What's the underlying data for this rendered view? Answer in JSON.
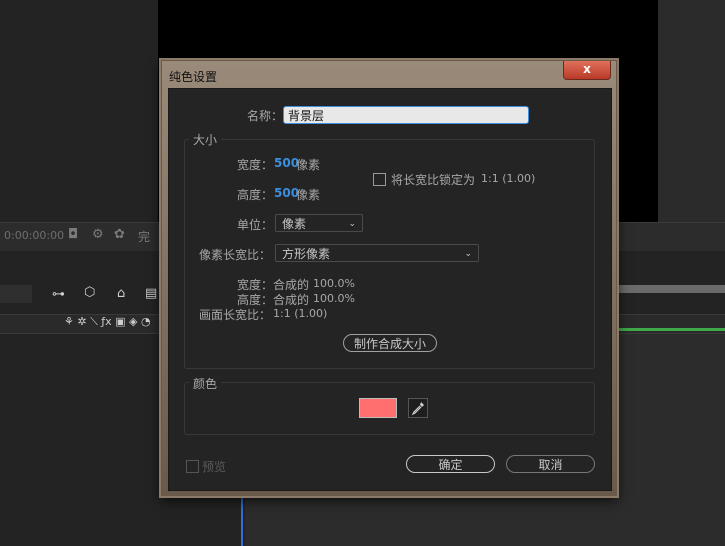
{
  "background": {
    "timecode": "0:00:00:00",
    "complete_label": "完"
  },
  "dialog": {
    "title": "纯色设置",
    "close_symbol": "x",
    "name_label": "名称：",
    "name_value": "背景层",
    "size_group": {
      "legend": "大小",
      "width_label": "宽度：",
      "width_value": "500",
      "width_unit": "像素",
      "height_label": "高度：",
      "height_value": "500",
      "height_unit": "像素",
      "lock_aspect_label": "将长宽比锁定为",
      "lock_aspect_value": "1:1 (1.00)",
      "units_label": "单位：",
      "units_value": "像素",
      "pixel_aspect_label": "像素长宽比：",
      "pixel_aspect_value": "方形像素",
      "info_width_label": "宽度：",
      "info_width_text": "合成的",
      "info_width_value": "100.0%",
      "info_height_label": "高度：",
      "info_height_text": "合成的",
      "info_height_value": "100.0%",
      "frame_aspect_label": "画面长宽比：",
      "frame_aspect_value": "1:1 (1.00)",
      "make_comp_size_button": "制作合成大小"
    },
    "color_group": {
      "legend": "颜色",
      "swatch_color": "#ff6f6f"
    },
    "preview_label": "预览",
    "ok_button": "确定",
    "cancel_button": "取消"
  }
}
